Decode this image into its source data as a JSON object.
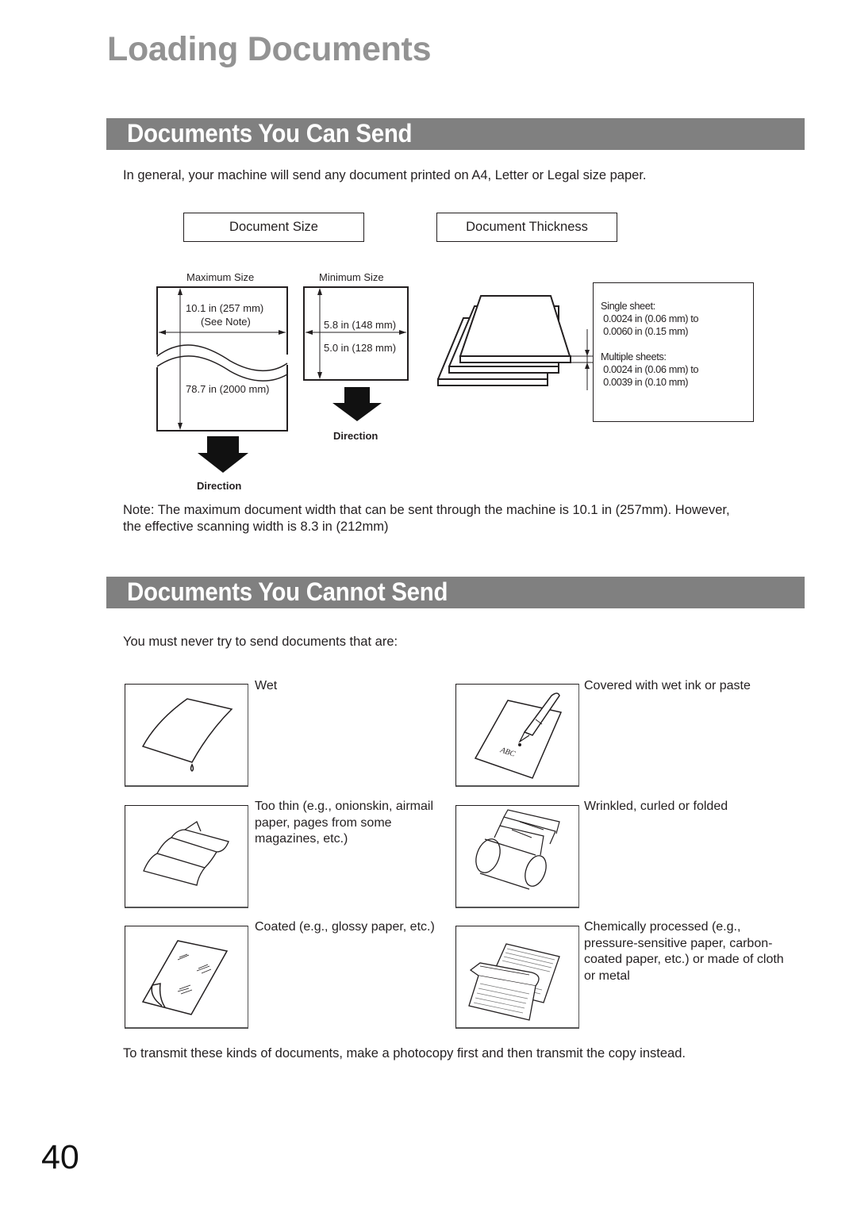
{
  "page_title": "Loading Documents",
  "section_can_send": {
    "heading": "Documents You Can Send",
    "intro": "In general, your machine will send any document printed on A4, Letter or Legal size paper.",
    "document_size_label": "Document Size",
    "document_thickness_label": "Document Thickness",
    "maximum_size": {
      "label": "Maximum Size",
      "width": "10.1 in (257 mm)",
      "width_note": "(See Note)",
      "length": "78.7 in (2000 mm)",
      "direction_label": "Direction"
    },
    "minimum_size": {
      "label": "Minimum Size",
      "width": "5.8 in (148 mm)",
      "length": "5.0 in (128 mm)",
      "direction_label": "Direction"
    },
    "thickness": {
      "single_label": "Single sheet:",
      "single_min": " 0.0024 in (0.06 mm) to",
      "single_max": " 0.0060 in (0.15 mm)",
      "multiple_label": "Multiple sheets:",
      "multiple_min": " 0.0024 in (0.06 mm) to",
      "multiple_max": " 0.0039 in (0.10 mm)"
    },
    "note_line1": "Note: The maximum document width that can be sent through the machine is 10.1 in (257mm). However,",
    "note_line2": "the effective scanning width is 8.3 in (212mm)"
  },
  "section_cannot_send": {
    "heading": "Documents You Cannot Send",
    "intro": "You must never try to send documents that are:",
    "items": [
      {
        "icon": "wet-paper-icon",
        "lines": [
          "Wet"
        ]
      },
      {
        "icon": "ink-pen-paper-icon",
        "lines": [
          "Covered with wet ink or paste"
        ],
        "illus_text": "ABC"
      },
      {
        "icon": "thin-paper-icon",
        "lines": [
          "Too thin (e.g., onionskin, airmail",
          "paper, pages from some",
          "magazines, etc.)"
        ]
      },
      {
        "icon": "wrinkled-paper-icon",
        "lines": [
          "Wrinkled, curled or folded"
        ]
      },
      {
        "icon": "glossy-paper-icon",
        "lines": [
          "Coated (e.g., glossy paper, etc.)"
        ]
      },
      {
        "icon": "carbon-paper-icon",
        "lines": [
          "Chemically processed (e.g.,",
          "pressure-sensitive paper, carbon-",
          "coated paper, etc.) or made of cloth",
          "or metal"
        ]
      }
    ],
    "footer": "To transmit these kinds of documents, make a photocopy first and then transmit the copy instead."
  },
  "page_number": "40"
}
